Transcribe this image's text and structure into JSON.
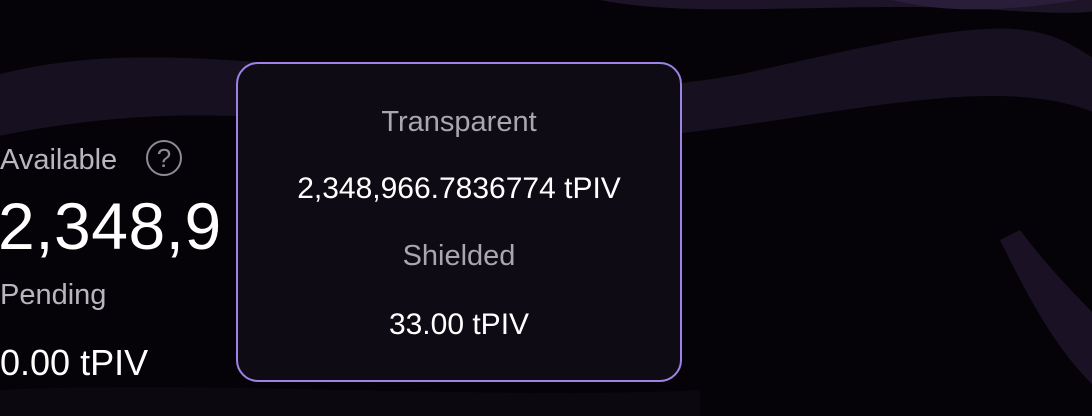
{
  "balance": {
    "available_label": "Available",
    "help_icon": "question-circle-icon",
    "help_glyph": "?",
    "available_amount_visible": "2,348,9",
    "pending_label": "Pending",
    "pending_amount": "0.00 tPIV"
  },
  "tooltip": {
    "transparent_label": "Transparent",
    "transparent_value": "2,348,966.7836774 tPIV",
    "shielded_label": "Shielded",
    "shielded_value": "33.00 tPIV"
  },
  "colors": {
    "background": "#050307",
    "tooltip_border": "#9d83e6",
    "tooltip_background": "#0f0b15",
    "muted_text": "#b9b6bf"
  }
}
